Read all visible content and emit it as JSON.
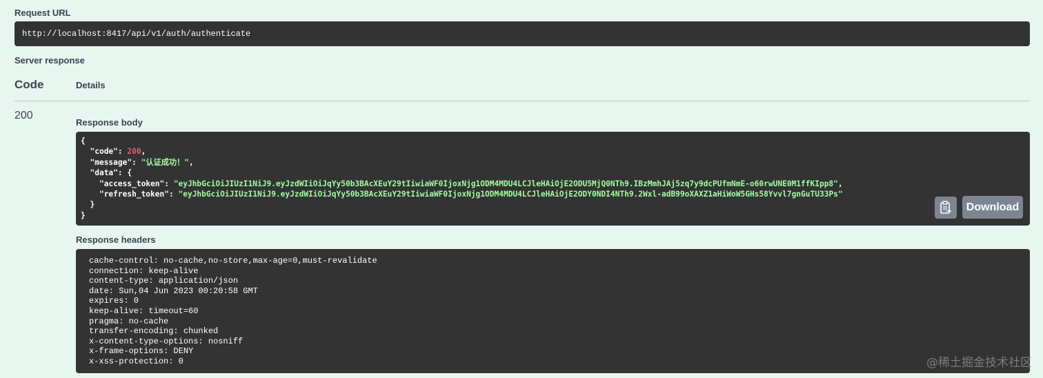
{
  "request_url": {
    "label": "Request URL",
    "value": "http://localhost:8417/api/v1/auth/authenticate"
  },
  "server_response": {
    "label": "Server response",
    "code_header": "Code",
    "details_header": "Details",
    "status_code": "200"
  },
  "response_body": {
    "label": "Response body",
    "open_brace": "{",
    "close_brace": "}",
    "lines": [
      {
        "indent": "  ",
        "key": "\"code\"",
        "sep": ": ",
        "value": "200",
        "value_type": "num",
        "trail": ","
      },
      {
        "indent": "  ",
        "key": "\"message\"",
        "sep": ": ",
        "value": "\"认证成功！\"",
        "value_type": "str",
        "trail": ","
      },
      {
        "indent": "  ",
        "key": "\"data\"",
        "sep": ": ",
        "value": "{",
        "value_type": "punc",
        "trail": ""
      },
      {
        "indent": "    ",
        "key": "\"access_token\"",
        "sep": ": ",
        "value": "\"eyJhbGciOiJIUzI1NiJ9.eyJzdWIiOiJqYy50b3BAcXEuY29tIiwiaWF0IjoxNjg1ODM4MDU4LCJleHAiOjE2ODU5MjQ0NTh9.IBzMmhJAj5zq7y9dcPUfmNmE-o60rwUNE0M1ffKIpp8\"",
        "value_type": "str",
        "trail": ","
      },
      {
        "indent": "    ",
        "key": "\"refresh_token\"",
        "sep": ": ",
        "value": "\"eyJhbGciOiJIUzI1NiJ9.eyJzdWIiOiJqYy50b3BAcXEuY29tIiwiaWF0IjoxNjg1ODM4MDU4LCJleHAiOjE2ODY0NDI4NTh9.2Wxl-adB99oXAXZ1aHiWoW5GHs58Yvvl7gnGuTU33Ps\"",
        "value_type": "str",
        "trail": ""
      },
      {
        "indent": "  ",
        "key": "",
        "sep": "",
        "value": "}",
        "value_type": "punc",
        "trail": ""
      }
    ],
    "copy_icon": "clipboard-icon",
    "download_label": "Download"
  },
  "response_headers": {
    "label": "Response headers",
    "lines": [
      "cache-control: no-cache,no-store,max-age=0,must-revalidate",
      "connection: keep-alive",
      "content-type: application/json",
      "date: Sun,04 Jun 2023 00:20:58 GMT",
      "expires: 0",
      "keep-alive: timeout=60",
      "pragma: no-cache",
      "transfer-encoding: chunked",
      "x-content-type-options: nosniff",
      "x-frame-options: DENY",
      "x-xss-protection: 0"
    ]
  },
  "watermark": "@稀土掘金技术社区",
  "colors": {
    "background": "#e8f6f0",
    "code_block": "#333333",
    "json_string": "#a2fca2",
    "json_number": "#d36363",
    "button": "#7d8492"
  }
}
